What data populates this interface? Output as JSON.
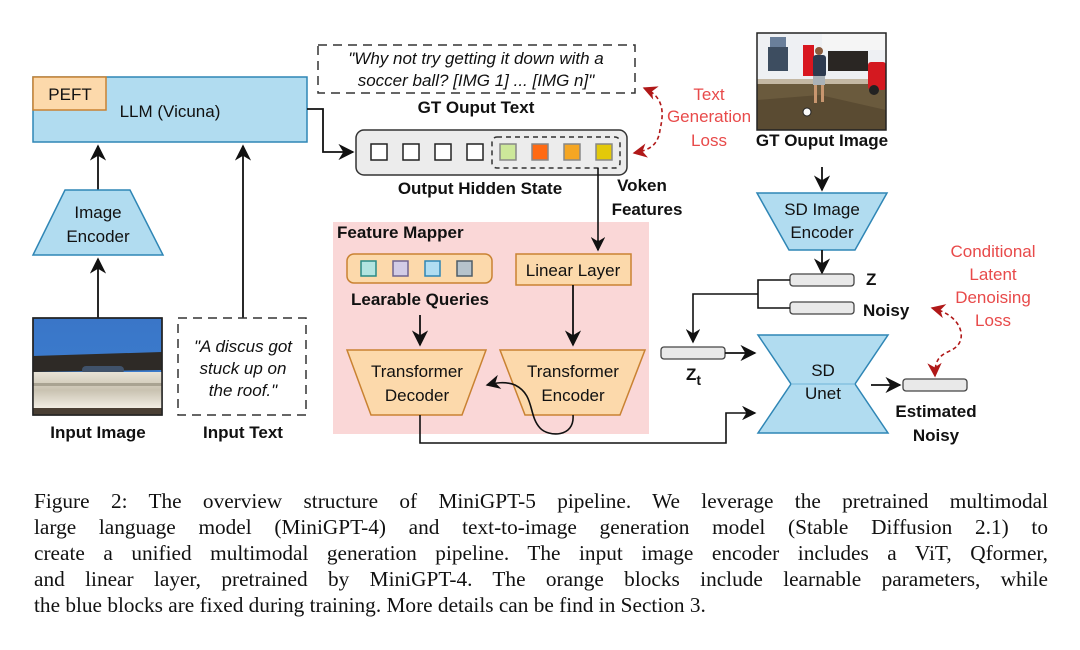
{
  "figure": {
    "llm": {
      "label": "LLM (Vicuna)",
      "peft_label": "PEFT"
    },
    "image_encoder": {
      "line1": "Image",
      "line2": "Encoder"
    },
    "input_image": {
      "label": "Input Image",
      "description": "roof gutter with discus against blue sky"
    },
    "input_text": {
      "lines": [
        "\"A discus got",
        "stuck up on",
        "the roof.\""
      ],
      "label": "Input Text"
    },
    "gt_output_text": {
      "lines": [
        "\"Why not try getting it down with a",
        "soccer ball? [IMG 1] ... [IMG n]\""
      ],
      "label": "GT Ouput Text"
    },
    "hidden_state": {
      "label": "Output Hidden State",
      "plain_tokens": 4,
      "voken_colors": [
        "#cde89a",
        "#ff6a13",
        "#f5a623",
        "#e3c90a"
      ],
      "voken_label_1": "Voken",
      "voken_label_2": "Features"
    },
    "text_loss": {
      "lines": [
        "Text",
        "Generation",
        "Loss"
      ]
    },
    "gt_output_image": {
      "label": "GT Ouput Image",
      "description": "person kicking soccer ball in front yard of house with red door and red car"
    },
    "sd_image_encoder": {
      "line1": "SD Image",
      "line2": "Encoder"
    },
    "latents": {
      "z": "Z",
      "noisy": "Noisy",
      "zt_main": "Z",
      "zt_sub": "t"
    },
    "feature_mapper": {
      "title": "Feature Mapper",
      "query_colors": [
        "#b2e4e0",
        "#d2cce6",
        "#b0ddf2",
        "#b6c3cc"
      ],
      "queries_label": "Learable Queries",
      "linear_layer": "Linear Layer",
      "decoder": {
        "line1": "Transformer",
        "line2": "Decoder"
      },
      "encoder": {
        "line1": "Transformer",
        "line2": "Encoder"
      }
    },
    "sd_unet": {
      "line1": "SD",
      "line2": "Unet"
    },
    "estimated_noisy": {
      "line1": "Estimated",
      "line2": "Noisy"
    },
    "denoise_loss": {
      "lines": [
        "Conditional",
        "Latent",
        "Denoising",
        "Loss"
      ]
    },
    "colors": {
      "blue_block": "#b1dcf0",
      "blue_stroke": "#2f86b5",
      "orange_block": "#fcd9ab",
      "orange_stroke": "#c98232",
      "mapper_bg": "#fad7d7",
      "loss_red": "#e84a4a",
      "loss_arrow": "#b01818"
    }
  },
  "caption": {
    "lines": [
      "Figure 2: The overview structure of MiniGPT-5 pipeline. We leverage the pretrained multimodal",
      "large language model (MiniGPT-4) and text-to-image generation model (Stable Diffusion 2.1) to",
      "create a unified multimodal generation pipeline. The input image encoder includes a ViT, Qformer,",
      "and linear layer, pretrained by MiniGPT-4. The orange blocks include learnable parameters, while",
      "the blue blocks are fixed during training. More details can be find in Section 3."
    ]
  }
}
